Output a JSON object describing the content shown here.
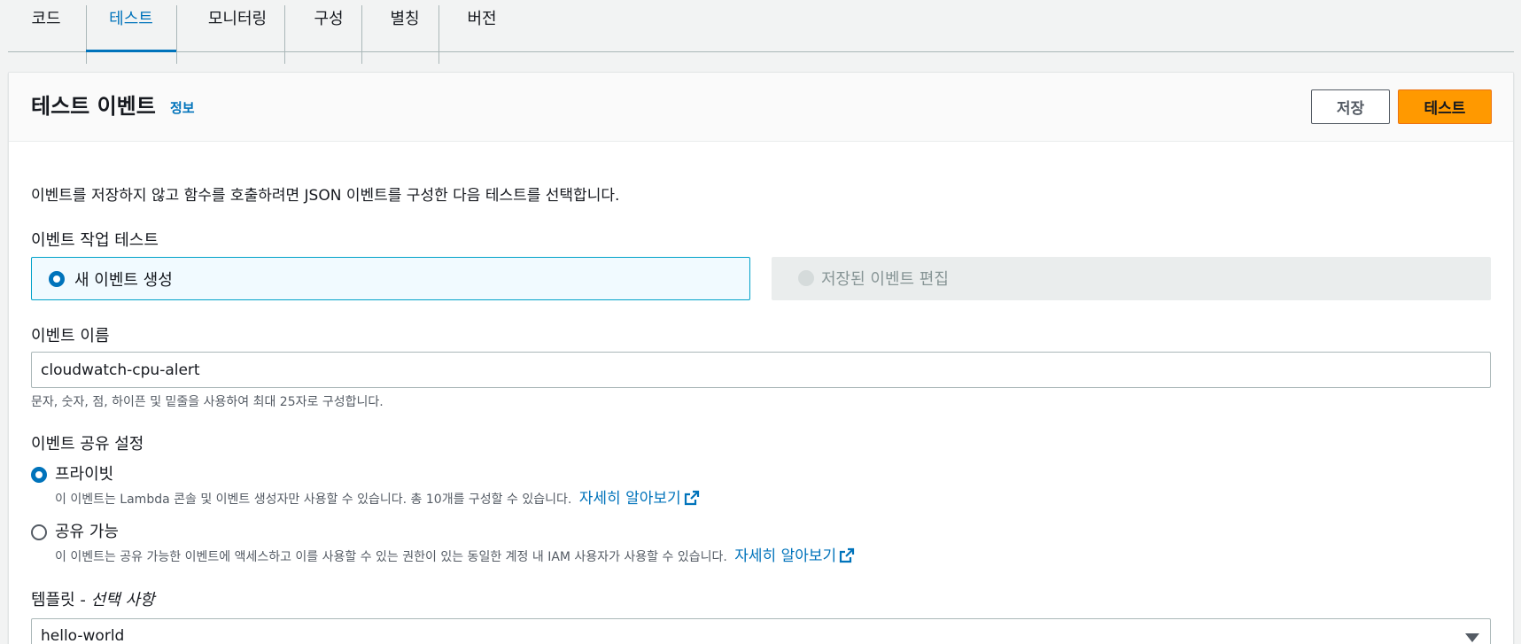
{
  "tabs": [
    {
      "label": "코드"
    },
    {
      "label": "테스트"
    },
    {
      "label": "모니터링"
    },
    {
      "label": "구성"
    },
    {
      "label": "별칭"
    },
    {
      "label": "버전"
    }
  ],
  "panel": {
    "title": "테스트 이벤트",
    "info_link": "정보",
    "save_label": "저장",
    "test_label": "테스트"
  },
  "description": "이벤트를 저장하지 않고 함수를 호출하려면 JSON 이벤트를 구성한 다음 테스트를 선택합니다.",
  "event_action": {
    "label": "이벤트 작업 테스트",
    "options": [
      {
        "label": "새 이벤트 생성"
      },
      {
        "label": "저장된 이벤트 편집"
      }
    ]
  },
  "event_name": {
    "label": "이벤트 이름",
    "value": "cloudwatch-cpu-alert",
    "hint": "문자, 숫자, 점, 하이픈 및 밑줄을 사용하여 최대 25자로 구성합니다."
  },
  "sharing": {
    "label": "이벤트 공유 설정",
    "private": {
      "label": "프라이빗",
      "desc": "이 이벤트는 Lambda 콘솔 및 이벤트 생성자만 사용할 수 있습니다. 총 10개를 구성할 수 있습니다.",
      "link": "자세히 알아보기"
    },
    "shareable": {
      "label": "공유 가능",
      "desc": "이 이벤트는 공유 가능한 이벤트에 액세스하고 이를 사용할 수 있는 권한이 있는 동일한 계정 내 IAM 사용자가 사용할 수 있습니다.",
      "link": "자세히 알아보기"
    }
  },
  "template": {
    "label": "템플릿 - ",
    "label_optional": "선택 사항",
    "value": "hello-world"
  },
  "colors": {
    "accent": "#0073bb",
    "primary_button": "#ff9900"
  }
}
